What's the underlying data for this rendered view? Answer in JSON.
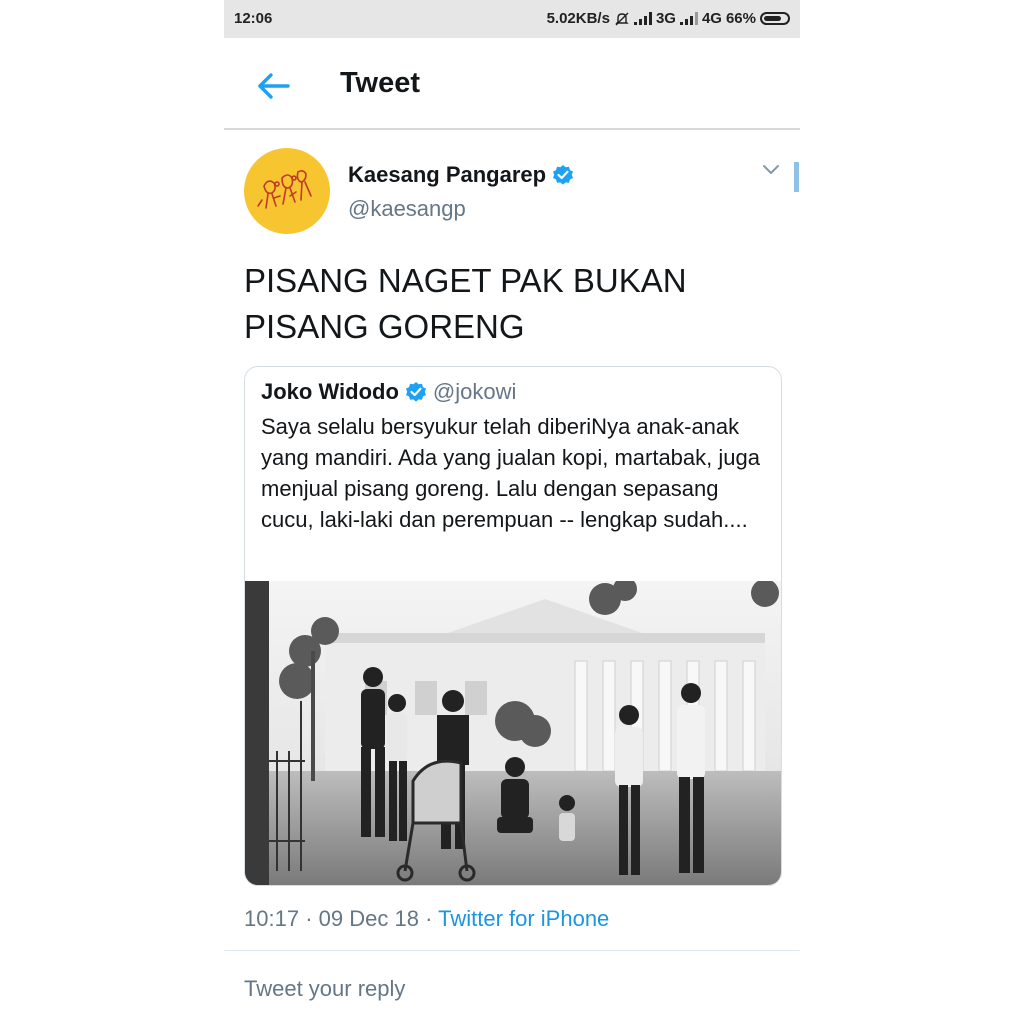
{
  "status_bar": {
    "time": "12:06",
    "network_speed": "5.02KB/s",
    "net1": "3G",
    "net2": "4G",
    "battery": "66%"
  },
  "header": {
    "title": "Tweet",
    "back_icon": "arrow-left-icon",
    "accent": "#1da1f2"
  },
  "tweet": {
    "author_name": "Kaesang Pangarep",
    "author_handle": "@kaesangp",
    "text": "PISANG NAGET PAK BUKAN PISANG GORENG",
    "avatar_color": "#f7c530"
  },
  "quote": {
    "author_name": "Joko Widodo",
    "author_handle": "@jokowi",
    "text": "Saya selalu bersyukur telah diberiNya anak-anak yang mandiri. Ada yang jualan kopi, martabak, juga menjual pisang goreng. Lalu dengan sepasang cucu, laki-laki dan perempuan -- lengkap sudah...."
  },
  "meta": {
    "time": "10:17",
    "separator": "·",
    "date": "09 Dec 18",
    "source": "Twitter for iPhone"
  },
  "reply": {
    "placeholder": "Tweet your reply"
  }
}
